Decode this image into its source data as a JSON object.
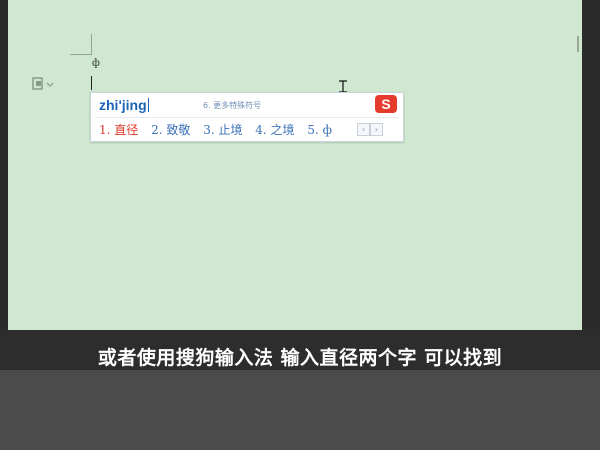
{
  "document": {
    "phi_symbol": "ф"
  },
  "ime": {
    "pinyin": "zhi'jing",
    "hint": "6. 更多特殊符号",
    "logo": "S",
    "candidates": [
      {
        "label": "1. 直径"
      },
      {
        "label": "2. 致敬"
      },
      {
        "label": "3. 止境"
      },
      {
        "label": "4. 之境"
      },
      {
        "label": "5. ф"
      }
    ],
    "prev_glyph": "‹",
    "next_glyph": "›"
  },
  "subtitle": {
    "text": "或者使用搜狗输入法 输入直径两个字 可以找到"
  },
  "colors": {
    "document_bg": "#cfe8cf",
    "pinyin": "#1d63b8",
    "selected_candidate": "#e03a2b",
    "candidate": "#3b72b9",
    "logo": "#e53b2c"
  }
}
